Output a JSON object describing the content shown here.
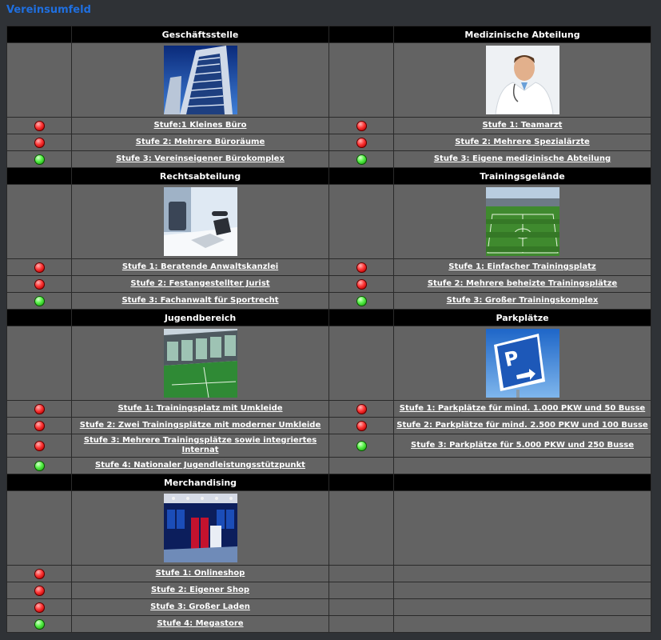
{
  "page": {
    "title": "Vereinsumfeld"
  },
  "status_colors": {
    "inactive": "#e02020",
    "active": "#3cd030"
  },
  "sections": {
    "office": {
      "title": "Geschäftsstelle",
      "image": "office-building-image",
      "levels": [
        {
          "label": "Stufe:1 Kleines Büro",
          "status": "inactive"
        },
        {
          "label": "Stufe 2: Mehrere Büroräume",
          "status": "inactive"
        },
        {
          "label": "Stufe 3: Vereinseigener Bürokomplex",
          "status": "active"
        }
      ]
    },
    "medical": {
      "title": "Medizinische Abteilung",
      "image": "doctor-image",
      "levels": [
        {
          "label": "Stufe 1: Teamarzt",
          "status": "inactive"
        },
        {
          "label": "Stufe 2: Mehrere Spezialärzte",
          "status": "inactive"
        },
        {
          "label": "Stufe 3: Eigene medizinische Abteilung",
          "status": "active"
        }
      ]
    },
    "legal": {
      "title": "Rechtsabteilung",
      "image": "office-desk-phone-image",
      "levels": [
        {
          "label": "Stufe 1: Beratende Anwaltskanzlei",
          "status": "inactive"
        },
        {
          "label": "Stufe 2: Festangestellter Jurist",
          "status": "inactive"
        },
        {
          "label": "Stufe 3: Fachanwalt für Sportrecht",
          "status": "active"
        }
      ]
    },
    "training": {
      "title": "Trainingsgelände",
      "image": "training-ground-image",
      "levels": [
        {
          "label": "Stufe 1: Einfacher Trainingsplatz",
          "status": "inactive"
        },
        {
          "label": "Stufe 2: Mehrere beheizte Trainingsplätze",
          "status": "inactive"
        },
        {
          "label": "Stufe 3: Großer Trainingskomplex",
          "status": "active"
        }
      ]
    },
    "youth": {
      "title": "Jugendbereich",
      "image": "youth-facility-image",
      "levels": [
        {
          "label": "Stufe 1: Trainingsplatz mit Umkleide",
          "status": "inactive"
        },
        {
          "label": "Stufe 2: Zwei Trainingsplätze mit moderner Umkleide",
          "status": "inactive"
        },
        {
          "label": "Stufe 3: Mehrere Trainingsplätze sowie integriertes Internat",
          "status": "inactive"
        },
        {
          "label": "Stufe 4: Nationaler Jugendleistungsstützpunkt",
          "status": "active"
        }
      ]
    },
    "parking": {
      "title": "Parkplätze",
      "image": "parking-sign-image",
      "levels": [
        {
          "label": "Stufe 1: Parkplätze für mind. 1.000 PKW und 50 Busse",
          "status": "inactive"
        },
        {
          "label": "Stufe 2: Parkplätze für mind. 2.500 PKW und 100 Busse",
          "status": "inactive"
        },
        {
          "label": "Stufe 3: Parkplätze für 5.000 PKW und 250 Busse",
          "status": "active"
        }
      ]
    },
    "merch": {
      "title": "Merchandising",
      "image": "merchandise-store-image",
      "levels": [
        {
          "label": "Stufe 1: Onlineshop",
          "status": "inactive"
        },
        {
          "label": "Stufe 2: Eigener Shop",
          "status": "inactive"
        },
        {
          "label": "Stufe 3: Großer Laden",
          "status": "inactive"
        },
        {
          "label": "Stufe 4: Megastore",
          "status": "active"
        }
      ]
    }
  }
}
